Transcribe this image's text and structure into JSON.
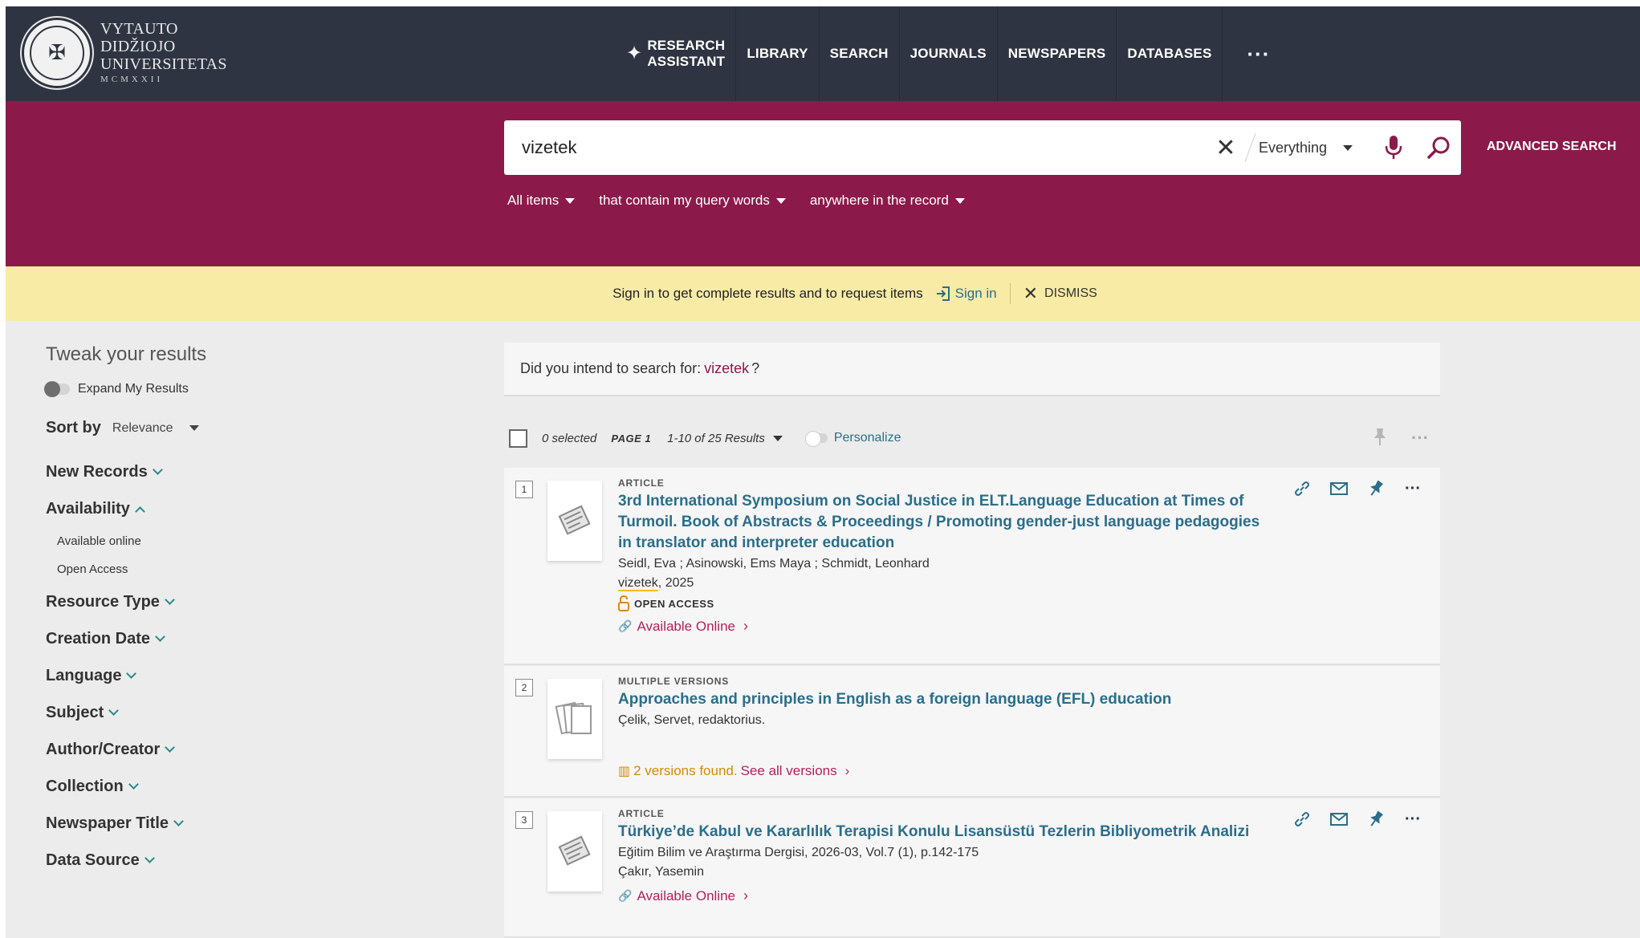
{
  "logo": {
    "line1": "VYTAUTO",
    "line2": "DIDŽIOJO",
    "line3": "UNIVERSITETAS",
    "line4": "MCMXXII"
  },
  "nav": {
    "research_assistant_line1": "RESEARCH",
    "research_assistant_line2": "ASSISTANT",
    "library": "LIBRARY",
    "search": "SEARCH",
    "journals": "JOURNALS",
    "newspapers": "NEWSPAPERS",
    "databases": "DATABASES",
    "more": "···"
  },
  "search": {
    "query": "vizetek",
    "scope": "Everything",
    "advanced": "ADVANCED SEARCH",
    "filter_items": "All items",
    "filter_match": "that contain my query words",
    "filter_where": "anywhere in the record"
  },
  "signbar": {
    "message": "Sign in to get complete results and to request items",
    "signin": "Sign in",
    "dismiss": "DISMISS"
  },
  "sidebar": {
    "title": "Tweak your results",
    "expand": "Expand My Results",
    "sort_label": "Sort by",
    "sort_value": "Relevance",
    "facets": {
      "new_records": "New Records",
      "availability": "Availability",
      "available_online": "Available online",
      "open_access": "Open Access",
      "resource_type": "Resource Type",
      "creation_date": "Creation Date",
      "language": "Language",
      "subject": "Subject",
      "author": "Author/Creator",
      "collection": "Collection",
      "newspaper_title": "Newspaper Title",
      "data_source": "Data Source"
    }
  },
  "didyou": {
    "prefix": "Did you intend to search for:",
    "term": "vizetek",
    "suffix": "?"
  },
  "toolbar": {
    "selected": "0 selected",
    "page": "PAGE 1",
    "range": "1-10 of 25 Results",
    "personalize": "Personalize"
  },
  "results": [
    {
      "num": "1",
      "type": "ARTICLE",
      "title": "3rd International Symposium on Social Justice in ELT.Language Education at Times of Turmoil. Book of Abstracts & Proceedings / Promoting gender-just language pedagogies in translator and interpreter education",
      "authors": "Seidl, Eva ; Asinowski, Ems Maya ; Schmidt, Leonhard",
      "source_hl": "vizetek",
      "source_rest": ", 2025",
      "oa": "OPEN ACCESS",
      "avail": "Available Online"
    },
    {
      "num": "2",
      "type": "MULTIPLE VERSIONS",
      "title": "Approaches and principles in English as a foreign language (EFL) education",
      "authors": "Çelik, Servet, redaktorius.",
      "versions": "2 versions found.",
      "see_all": "See all versions"
    },
    {
      "num": "3",
      "type": "ARTICLE",
      "title": "Türkiye’de Kabul ve Kararlılık Terapisi Konulu Lisansüstü Tezlerin Bibliyometrik Analizi",
      "source": "Eğitim Bilim ve Araştırma Dergisi, 2026-03, Vol.7 (1), p.142-175",
      "authors": "Çakır, Yasemin",
      "avail": "Available Online"
    }
  ],
  "colors": {
    "nav_bg": "#2f3442",
    "search_band": "#8b1a4a",
    "signbar_bg": "#f8eba5",
    "link_teal": "#2b6e8a",
    "link_magenta": "#b0225a"
  }
}
